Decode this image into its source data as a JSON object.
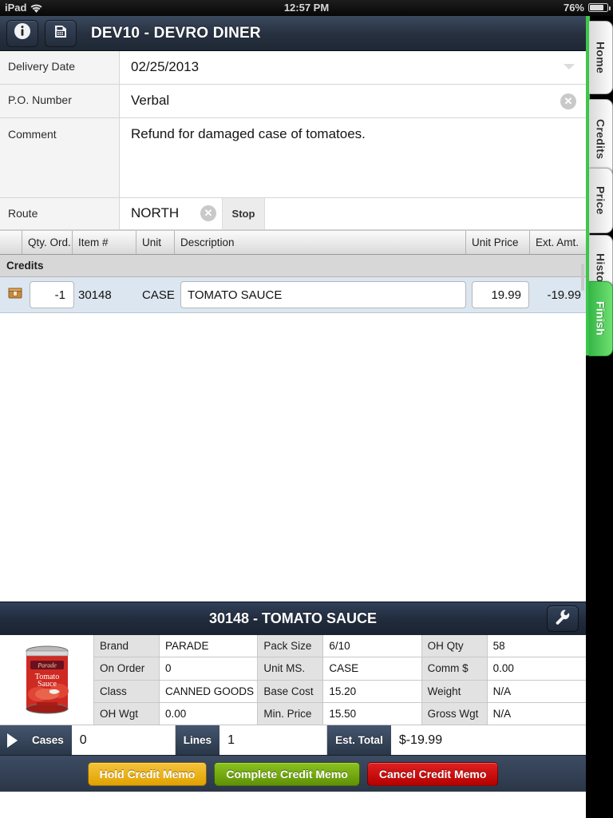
{
  "status_bar": {
    "carrier": "iPad",
    "wifi_icon": "wifi-icon",
    "time": "12:57 PM",
    "battery_percent": "76%",
    "battery_icon": "battery-icon"
  },
  "navbar": {
    "info_icon": "info-icon",
    "calculator_icon": "calculator-icon",
    "title": "DEV10 - DEVRO DINER"
  },
  "form": {
    "delivery_date": {
      "label": "Delivery Date",
      "value": "02/25/2013",
      "dropdown_icon": "chevron-down-icon"
    },
    "po_number": {
      "label": "P.O. Number",
      "value": "Verbal",
      "clear_icon": "clear-circle-icon"
    },
    "comment": {
      "label": "Comment",
      "value": "Refund for damaged case of tomatoes."
    },
    "route": {
      "label": "Route",
      "value": "NORTH",
      "clear_icon": "clear-circle-icon",
      "stop_label": "Stop"
    }
  },
  "items_table": {
    "columns": [
      "",
      "Qty. Ord.",
      "Item #",
      "Unit",
      "Description",
      "Unit Price",
      "Ext. Amt."
    ],
    "group_label": "Credits",
    "rows": [
      {
        "row_icon": "package-box-icon",
        "qty": "-1",
        "item_number": "30148",
        "unit": "CASE",
        "description": "TOMATO SAUCE",
        "unit_price": "19.99",
        "ext_amount": "-19.99"
      }
    ]
  },
  "detail_panel": {
    "title": "30148 - TOMATO SAUCE",
    "wrench_icon": "wrench-icon",
    "product_image": "tomato-sauce-can-image",
    "specs": [
      [
        {
          "key": "Brand",
          "value": "PARADE"
        },
        {
          "key": "On Order",
          "value": "0"
        },
        {
          "key": "Class",
          "value": "CANNED GOODS"
        },
        {
          "key": "OH Wgt",
          "value": "0.00"
        }
      ],
      [
        {
          "key": "Pack Size",
          "value": "6/10"
        },
        {
          "key": "Unit MS.",
          "value": "CASE"
        },
        {
          "key": "Base Cost",
          "value": "15.20"
        },
        {
          "key": "Min. Price",
          "value": "15.50"
        }
      ],
      [
        {
          "key": "OH Qty",
          "value": "58"
        },
        {
          "key": "Comm $",
          "value": "0.00"
        },
        {
          "key": "Weight",
          "value": "N/A"
        },
        {
          "key": "Gross Wgt",
          "value": "N/A"
        }
      ]
    ]
  },
  "totals_bar": {
    "expand_icon": "play-triangle-icon",
    "cases_label": "Cases",
    "cases_value": "0",
    "lines_label": "Lines",
    "lines_value": "1",
    "est_total_label": "Est. Total",
    "est_total_value": "$-19.99"
  },
  "actions": {
    "hold": "Hold Credit Memo",
    "complete": "Complete Credit Memo",
    "cancel": "Cancel Credit Memo"
  },
  "side_tabs": [
    {
      "label": "Home",
      "active": false
    },
    {
      "label": "Credits",
      "active": false
    },
    {
      "label": "Price",
      "active": false
    },
    {
      "label": "History",
      "active": false
    },
    {
      "label": "Finish",
      "active": true
    }
  ],
  "colors": {
    "navbar": "#26303f",
    "accent_green": "#3cc84b",
    "row_highlight": "#dce6f0",
    "hold_button": "#e1a200",
    "complete_button": "#5f9206",
    "cancel_button": "#b50000"
  }
}
